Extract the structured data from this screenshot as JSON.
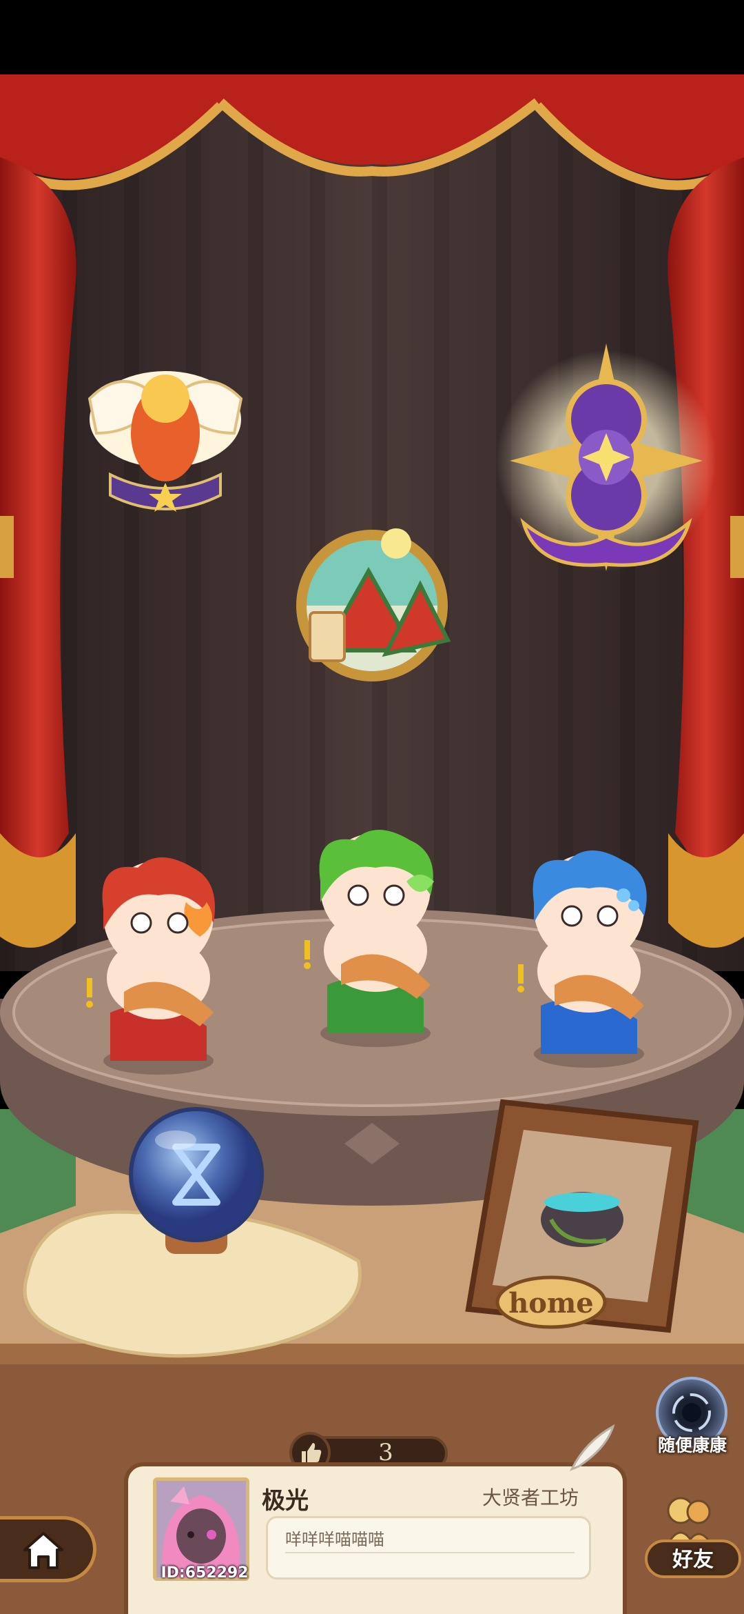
{
  "player": {
    "name": "极光",
    "id": "ID:652292",
    "workshop": "大贤者工坊",
    "message": "咩咩咩喵喵喵"
  },
  "likes": {
    "count": "3"
  },
  "buttons": {
    "random_visit": "随便康康",
    "friends": "好友"
  },
  "decor": {
    "photo_frame_label": "home"
  },
  "badges": [
    "winged-torch-badge",
    "watermelon-summer-badge",
    "purple-star-badge"
  ],
  "characters": [
    "fire-sprite",
    "leaf-sprite",
    "water-sprite"
  ],
  "colors": {
    "curtain": "#c0261c",
    "backdrop": "#3a2d2c",
    "stage": "#9d8274",
    "button_brown": "#4a2c1a",
    "gold_trim": "#c58a42"
  }
}
